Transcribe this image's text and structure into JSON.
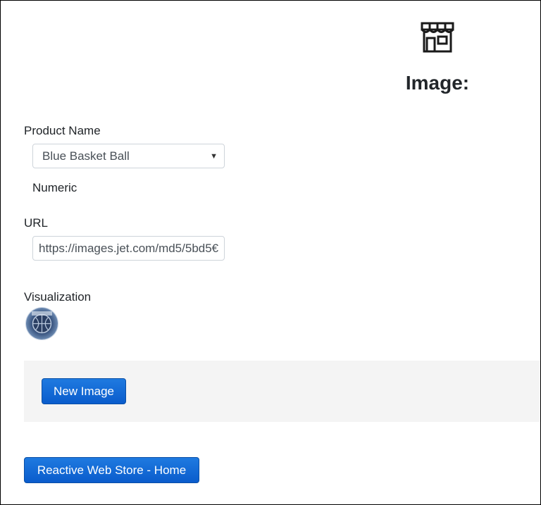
{
  "header": {
    "icon": "store-icon",
    "heading": "Image:"
  },
  "form": {
    "product_label": "Product Name",
    "product_value": "Blue Basket Ball",
    "product_sub_label": "Numeric",
    "url_label": "URL",
    "url_value": "https://images.jet.com/md5/5bd5€",
    "visualization_label": "Visualization"
  },
  "actions": {
    "new_image_label": "New Image",
    "home_label": "Reactive Web Store - Home"
  },
  "colors": {
    "primary_button": "#0a5ccc",
    "panel_background": "#f4f4f4",
    "text": "#212529"
  }
}
